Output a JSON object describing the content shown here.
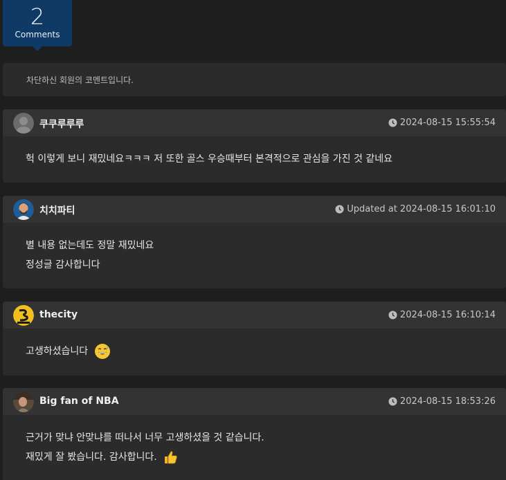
{
  "count": {
    "number": "2",
    "label": "Comments"
  },
  "blocked_notice": "차단하신 회원의 코멘트입니다.",
  "comments": [
    {
      "user": "쿠쿠루루루",
      "date": "2024-08-15 15:55:54",
      "lines": [
        "헉 이렇게 보니 재밌네요ㅋㅋㅋ 저 또한 골스 우승때부터 본격적으로 관심을 가진 것 같네요"
      ]
    },
    {
      "user": "치치파티",
      "date": "Updated at 2024-08-15 16:01:10",
      "lines": [
        "별 내용 없는데도 정말 재밌네요",
        "정성글 감사합니다"
      ]
    },
    {
      "user": "thecity",
      "date": "2024-08-15 16:10:14",
      "lines": [
        "고생하셨습니다"
      ]
    },
    {
      "user": "Big fan of NBA",
      "date": "2024-08-15 18:53:26",
      "lines": [
        "근거가 맞냐 안맞냐를 떠나서 너무 고생하셨을 것 같습니다.",
        "재밌게 잘 봤습니다. 감사합니다."
      ]
    }
  ],
  "colors": {
    "badge": "#0f3a66",
    "card": "#2b2b2b",
    "card_head": "#333333",
    "background": "#1e1e1e"
  },
  "icons": [
    "clock-icon",
    "default-avatar-icon",
    "sweat-smile-emoji",
    "thumbs-up-emoji"
  ]
}
